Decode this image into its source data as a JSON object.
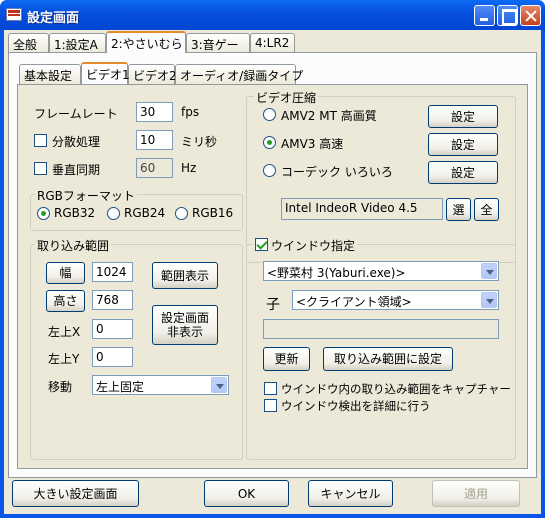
{
  "window": {
    "title": "設定画面"
  },
  "top_tabs": [
    "全般",
    "1:設定A",
    "2:やさいむら",
    "3:音ゲー",
    "4:LR2"
  ],
  "sub_tabs": [
    "基本設定",
    "ビデオ1",
    "ビデオ2",
    "オーディオ/録画タイプ"
  ],
  "frame": {
    "framerate_label": "フレームレート",
    "framerate_value": "30",
    "framerate_unit": "fps",
    "dispersion_label": "分散処理",
    "dispersion_value": "10",
    "dispersion_unit": "ミリ秒",
    "vsync_label": "垂直同期",
    "vsync_value": "60",
    "vsync_unit": "Hz"
  },
  "rgb": {
    "title": "RGBフォーマット",
    "options": [
      "RGB32",
      "RGB24",
      "RGB16"
    ],
    "selected": "RGB32"
  },
  "compress": {
    "title": "ビデオ圧縮",
    "options": [
      "AMV2 MT 高画質",
      "AMV3 高速",
      "コーデック いろいろ"
    ],
    "selected": "AMV3 高速",
    "set_label": "設定",
    "codec_value": "Intel IndeoR Video 4.5",
    "select_btn": "選",
    "all_btn": "全"
  },
  "capture": {
    "title": "取り込み範囲",
    "width_btn": "幅",
    "width_value": "1024",
    "height_btn": "高さ",
    "height_value": "768",
    "range_btn": "範囲表示",
    "hide_btn_line1": "設定画面",
    "hide_btn_line2": "非表示",
    "left_x_label": "左上X",
    "left_x_value": "0",
    "left_y_label": "左上Y",
    "left_y_value": "0",
    "move_label": "移動",
    "move_value": "左上固定"
  },
  "window_spec": {
    "title": "ウインドウ指定",
    "checked": true,
    "window_value": "<野菜村 3(Yaburi.exe)>",
    "child_label": "子",
    "child_value": "<クライアント領域>",
    "extra_value": "",
    "update_btn": "更新",
    "set_range_btn": "取り込み範囲に設定",
    "capture_inner_label": "ウインドウ内の取り込み範囲をキャプチャー",
    "detail_label": "ウインドウ検出を詳細に行う"
  },
  "bottom": {
    "big_btn": "大きい設定画面",
    "ok_btn": "OK",
    "cancel_btn": "キャンセル",
    "apply_btn": "適用"
  }
}
